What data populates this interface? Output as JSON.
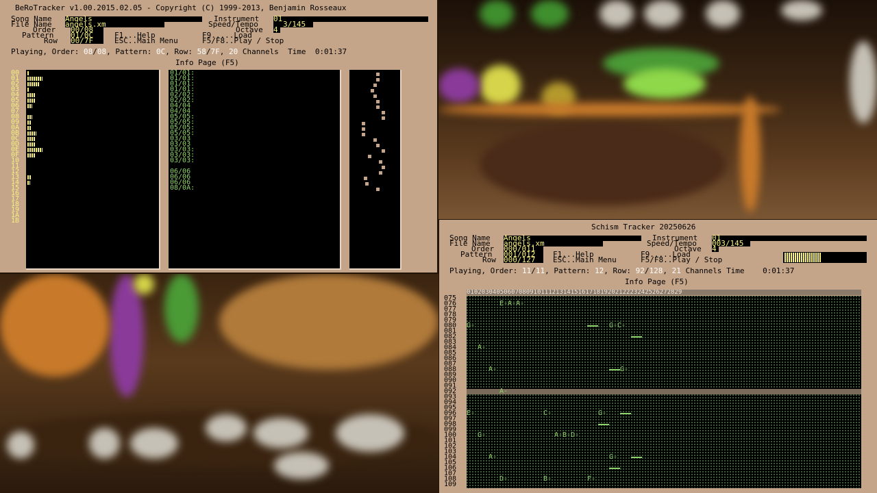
{
  "bero": {
    "title": "BeRoTracker v1.00.2015.02.05 - Copyright (C) 1999-2013, Benjamin Rosseaux",
    "labels": {
      "song_name": "Song Name",
      "file_name": "File Name",
      "order": "Order",
      "pattern": "Pattern",
      "row": "Row",
      "instrument": "Instrument",
      "speed_tempo": "Speed/Tempo",
      "octave": "Octave"
    },
    "values": {
      "song_name": "Angels",
      "file_name": "angels.xm",
      "order": "00/08",
      "pattern": "01/0C",
      "row": "00/7F",
      "instrument": "01",
      "speed_tempo": "3/145",
      "octave": "4"
    },
    "help": {
      "f1": "F1...Help",
      "esc": "ESC..Main Menu",
      "f9": "F9.....Load",
      "f5": "F5/F8..Play / Stop"
    },
    "status": {
      "playing_label": "Playing, Order:",
      "order_cur": "08",
      "order_total": "08",
      "pattern_label": "Pattern:",
      "pattern_val": "0C",
      "row_label": "Row:",
      "row_cur": "58",
      "row_total": "7F",
      "channels_val": "20",
      "channels_label": "Channels",
      "time_label": "Time",
      "time_val": "0:01:37"
    },
    "info_page": "Info Page (F5)",
    "channel_numbers": [
      "00",
      "01",
      "02",
      "03",
      "04",
      "05",
      "06",
      "07",
      "08",
      "09",
      "0A",
      "0B",
      "0C",
      "0D",
      "0E",
      "0F",
      "10",
      "11",
      "12",
      "13",
      "14",
      "15",
      "16",
      "17",
      "18",
      "19",
      "1A",
      "1B"
    ],
    "vu_levels": [
      0.1,
      0.9,
      0.7,
      0.1,
      0.5,
      0.5,
      0.3,
      0,
      0.3,
      0.2,
      0.2,
      0.55,
      0.45,
      0.45,
      0.9,
      0.5,
      0,
      0,
      0,
      0.2,
      0.15,
      0,
      0,
      0,
      0,
      0,
      0,
      0
    ],
    "sample_rows": [
      "01/01:",
      "01/01:",
      "01/01:",
      "01/01:",
      "02/02:",
      "02/02:",
      "04/04",
      "04/04",
      "05/05:",
      "05/05:",
      "05/05:",
      "05/05:",
      "03/03",
      "03/03",
      "03/03:",
      "03/03:",
      "03/03:",
      "",
      "06/06",
      "06/06",
      "06/06",
      "08/0A:"
    ]
  },
  "schism": {
    "title": "Schism Tracker 20250626",
    "labels": {
      "song_name": "Song Name",
      "file_name": "File Name",
      "order": "Order",
      "pattern": "Pattern",
      "row": "Row",
      "instrument": "Instrument",
      "speed_tempo": "Speed/Tempo",
      "octave": "Octave"
    },
    "values": {
      "song_name": "Angels",
      "file_name": "angels.xm",
      "order": "000/011",
      "pattern": "001/012",
      "row": "000/127",
      "instrument": "01",
      "speed_tempo": "003/145",
      "octave": "4"
    },
    "help": {
      "f1": "F1...Help",
      "esc": "ESC..Main Menu",
      "f9": "F9.....Load",
      "f5": "F5/F8..Play / Stop"
    },
    "status": {
      "playing_label": "Playing, Order:",
      "order_cur": "11",
      "order_total": "11",
      "pattern_label": "Pattern:",
      "pattern_val": "12",
      "row_label": "Row:",
      "row_cur": "92",
      "row_total": "128",
      "channels_val": "21",
      "channels_label": "Channels",
      "time_label": "Time",
      "time_val": "0:01:37"
    },
    "info_page": "Info Page (F5)",
    "channel_header": "0102030405060708091011121314151617181920212223242526272829",
    "row_numbers": [
      "075",
      "076",
      "077",
      "078",
      "079",
      "080",
      "081",
      "082",
      "083",
      "084",
      "085",
      "086",
      "087",
      "088",
      "089",
      "090",
      "091",
      "092",
      "093",
      "094",
      "095",
      "096",
      "097",
      "098",
      "099",
      "100",
      "101",
      "102",
      "103",
      "104",
      "105",
      "106",
      "107",
      "108",
      "109"
    ],
    "current_row": "092",
    "vu_level": 0.45,
    "notes": [
      {
        "row": "076",
        "col": 3,
        "text": "E-A-A-"
      },
      {
        "row": "080",
        "col": 0,
        "text": "G-"
      },
      {
        "row": "080",
        "col": 13,
        "text": "G-C-"
      },
      {
        "row": "084",
        "col": 1,
        "text": "A-"
      },
      {
        "row": "088",
        "col": 2,
        "text": "A-"
      },
      {
        "row": "088",
        "col": 14,
        "text": "G-"
      },
      {
        "row": "092",
        "col": 3,
        "text": "A-"
      },
      {
        "row": "096",
        "col": 0,
        "text": "E-"
      },
      {
        "row": "096",
        "col": 7,
        "text": "C-"
      },
      {
        "row": "096",
        "col": 12,
        "text": "G-"
      },
      {
        "row": "100",
        "col": 1,
        "text": "G-"
      },
      {
        "row": "100",
        "col": 8,
        "text": "A-B-D-"
      },
      {
        "row": "104",
        "col": 2,
        "text": "A-"
      },
      {
        "row": "104",
        "col": 13,
        "text": "G-"
      },
      {
        "row": "108",
        "col": 3,
        "text": "D-"
      },
      {
        "row": "108",
        "col": 7,
        "text": "B-"
      },
      {
        "row": "108",
        "col": 11,
        "text": "F-"
      }
    ]
  }
}
